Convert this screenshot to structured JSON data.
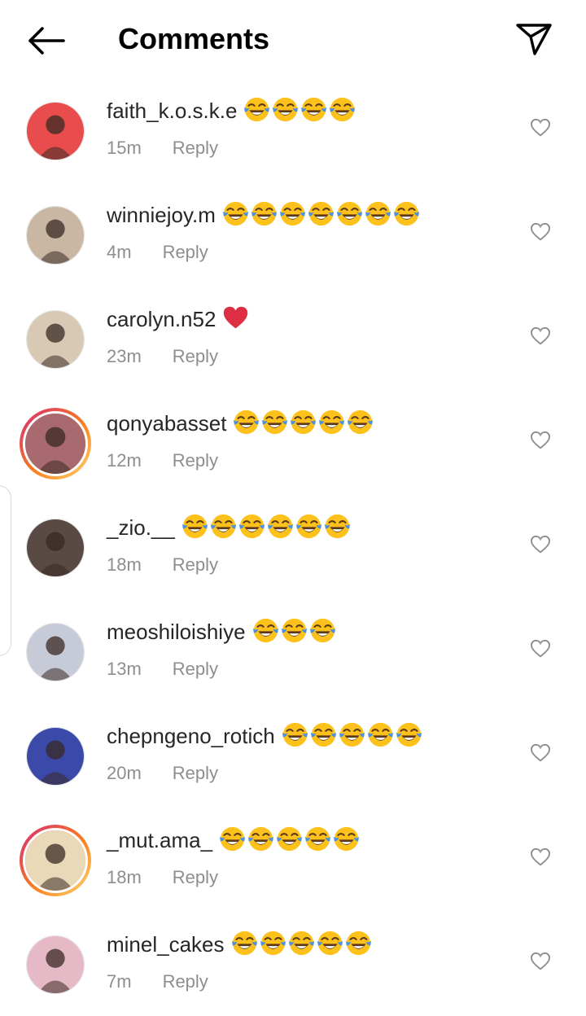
{
  "header": {
    "title": "Comments",
    "back_icon": "arrow-left-icon",
    "share_icon": "paper-plane-icon"
  },
  "colors": {
    "text": "#262626",
    "muted": "#8e8e8e",
    "story_ring_start": "#d62976",
    "story_ring_end": "#feda75",
    "heart": "#e0245e",
    "emoji_face": "#fcc21b",
    "emoji_tear": "#4a90e2"
  },
  "comments": [
    {
      "username": "faith_k.o.s.k.e",
      "emoji": "laughing-tears-icon",
      "emoji_count": 4,
      "time": "15m",
      "reply": "Reply",
      "story": false,
      "avatar_bg": "#e84c4c"
    },
    {
      "username": "winniejoy.m",
      "emoji": "laughing-tears-icon",
      "emoji_count": 7,
      "time": "4m",
      "reply": "Reply",
      "story": false,
      "avatar_bg": "#c9b7a3"
    },
    {
      "username": "carolyn.n52",
      "emoji": "red-heart-icon",
      "emoji_count": 1,
      "time": "23m",
      "reply": "Reply",
      "story": false,
      "avatar_bg": "#d8c9b4"
    },
    {
      "username": "qonyabasset",
      "emoji": "laughing-tears-icon",
      "emoji_count": 5,
      "time": "12m",
      "reply": "Reply",
      "story": true,
      "avatar_bg": "#a86a6e"
    },
    {
      "username": "_zio.__",
      "emoji": "laughing-tears-icon",
      "emoji_count": 6,
      "time": "18m",
      "reply": "Reply",
      "story": false,
      "avatar_bg": "#5a4a44"
    },
    {
      "username": "meoshiloishiye",
      "emoji": "laughing-tears-icon",
      "emoji_count": 3,
      "time": "13m",
      "reply": "Reply",
      "story": false,
      "avatar_bg": "#c7cbd8"
    },
    {
      "username": "chepngeno_rotich",
      "emoji": "laughing-tears-icon",
      "emoji_count": 5,
      "time": "20m",
      "reply": "Reply",
      "story": false,
      "avatar_bg": "#3b4aa8"
    },
    {
      "username": "_mut.ama_",
      "emoji": "laughing-tears-icon",
      "emoji_count": 5,
      "time": "18m",
      "reply": "Reply",
      "story": true,
      "avatar_bg": "#e9d9b8"
    },
    {
      "username": "minel_cakes",
      "emoji": "laughing-tears-icon",
      "emoji_count": 5,
      "time": "7m",
      "reply": "Reply",
      "story": false,
      "avatar_bg": "#e6b9c6"
    }
  ]
}
